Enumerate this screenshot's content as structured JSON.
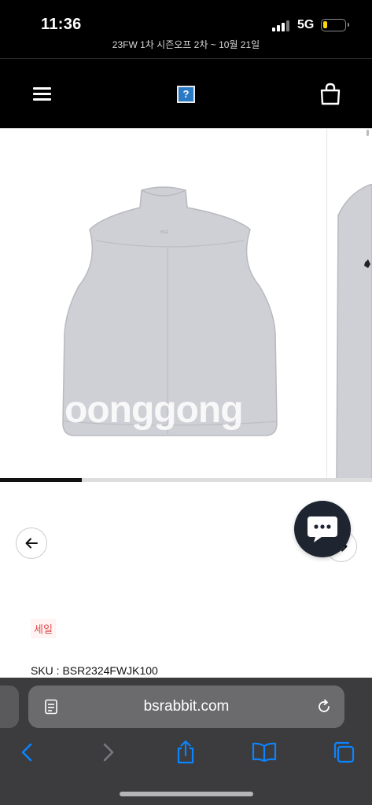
{
  "status_bar": {
    "time": "11:36",
    "network": "5G",
    "battery_level": 0.18
  },
  "announcement": {
    "text": "23FW 1차 시즌오프 2차 ~ 10월 21일 "
  },
  "header": {
    "logo_glyph": "?",
    "menu_icon": "hamburger-icon",
    "cart_icon": "shopping-bag-icon"
  },
  "gallery": {
    "watermark": "oonggong",
    "prev_icon": "arrow-left-icon",
    "next_icon": "arrow-right-icon",
    "progress": 0.22
  },
  "chat": {
    "icon": "chat-bubble-icon"
  },
  "product": {
    "sale_badge": "세일",
    "sku": "SKU : BSR2324FWJK100"
  },
  "browser": {
    "url": "bsrabbit.com",
    "page_icon": "page-icon",
    "reload_icon": "reload-icon",
    "toolbar": [
      "back-icon",
      "forward-icon",
      "share-icon",
      "bookmarks-icon",
      "tabs-icon"
    ]
  },
  "colors": {
    "header_bg": "#000000",
    "accent_blue": "#0a84ff",
    "sale_red": "#e04a4a",
    "chat_bg": "#1e2531",
    "safari_bg": "#3c3c3e"
  }
}
